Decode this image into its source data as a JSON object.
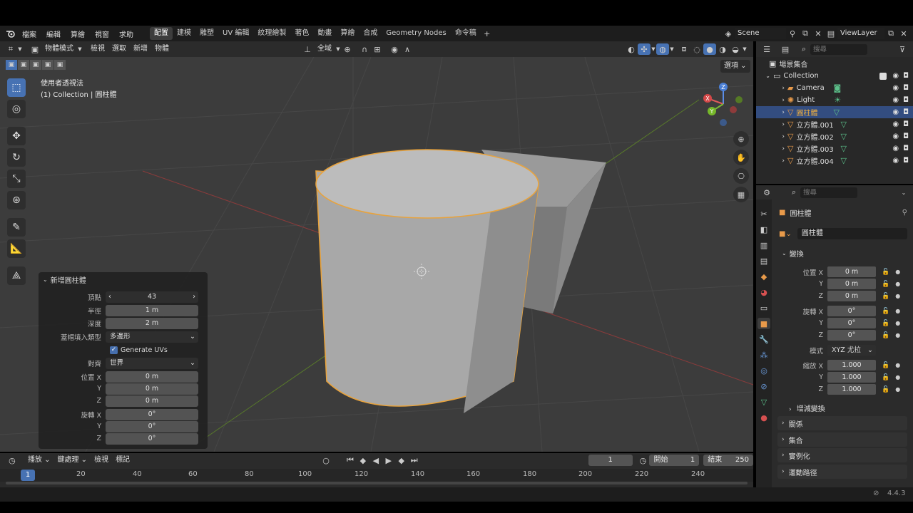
{
  "menu": {
    "items": [
      "檔案",
      "編輯",
      "算繪",
      "視窗",
      "求助"
    ],
    "workspaces": [
      "配置",
      "建模",
      "雕塑",
      "UV 編輯",
      "紋理繪製",
      "著色",
      "動畫",
      "算繪",
      "合成",
      "Geometry Nodes",
      "命令稿"
    ],
    "active_workspace": "配置",
    "scene": "Scene",
    "view_layer": "ViewLayer"
  },
  "viewport_header": {
    "mode": "物體模式",
    "menus": [
      "檢視",
      "選取",
      "新增",
      "物體"
    ],
    "transform_orientation": "全域",
    "options": "選項"
  },
  "viewport": {
    "view_name": "使用者透視法",
    "collection_info": "(1) Collection | 圓柱體",
    "gizmo_axes": [
      "X",
      "Y",
      "Z"
    ]
  },
  "operator_panel": {
    "title": "新增圓柱體",
    "vertices_label": "頂點",
    "vertices": "43",
    "radius_label": "半徑",
    "radius": "1 m",
    "depth_label": "深度",
    "depth": "2 m",
    "cap_fill_label": "蓋帽填入類型",
    "cap_fill": "多邊形",
    "generate_uvs": "Generate UVs",
    "align_label": "對齊",
    "align": "世界",
    "location_label": "位置 X",
    "loc_x": "0 m",
    "loc_y": "0 m",
    "loc_z": "0 m",
    "rotation_label": "旋轉 X",
    "rot_x": "0°",
    "rot_y": "0°",
    "rot_z": "0°",
    "y": "Y",
    "z": "Z"
  },
  "outliner": {
    "search_placeholder": "搜尋",
    "root": "場景集合",
    "collection": "Collection",
    "items": [
      "Camera",
      "Light",
      "圓柱體",
      "立方體.001",
      "立方體.002",
      "立方體.003",
      "立方體.004"
    ],
    "selected": "圓柱體"
  },
  "properties": {
    "search_placeholder": "搜尋",
    "object_name": "圓柱體",
    "data_name": "圓柱體",
    "transform_section": "變換",
    "location_label": "位置 X",
    "loc": [
      "0 m",
      "0 m",
      "0 m"
    ],
    "rotation_label": "旋轉 X",
    "rot": [
      "0°",
      "0°",
      "0°"
    ],
    "mode_label": "模式",
    "mode": "XYZ 尤拉",
    "scale_label": "縮放 X",
    "scale": [
      "1.000",
      "1.000",
      "1.000"
    ],
    "delta": "增減變換",
    "sections": [
      "關係",
      "集合",
      "實例化",
      "運動路徑"
    ],
    "y": "Y",
    "z": "Z"
  },
  "timeline": {
    "menus": [
      "播放",
      "鍵處理",
      "檢視",
      "標記"
    ],
    "current_frame": "1",
    "start_label": "開始",
    "start": "1",
    "end_label": "結束",
    "end": "250",
    "ruler": [
      "1",
      "20",
      "40",
      "60",
      "80",
      "100",
      "120",
      "140",
      "160",
      "180",
      "200",
      "220",
      "240"
    ]
  },
  "status": {
    "version": "4.4.3"
  },
  "colors": {
    "accent": "#4772b3",
    "selection_outline": "#e8a33d",
    "header": "#2b2b2b",
    "viewport": "#3c3c3c"
  }
}
